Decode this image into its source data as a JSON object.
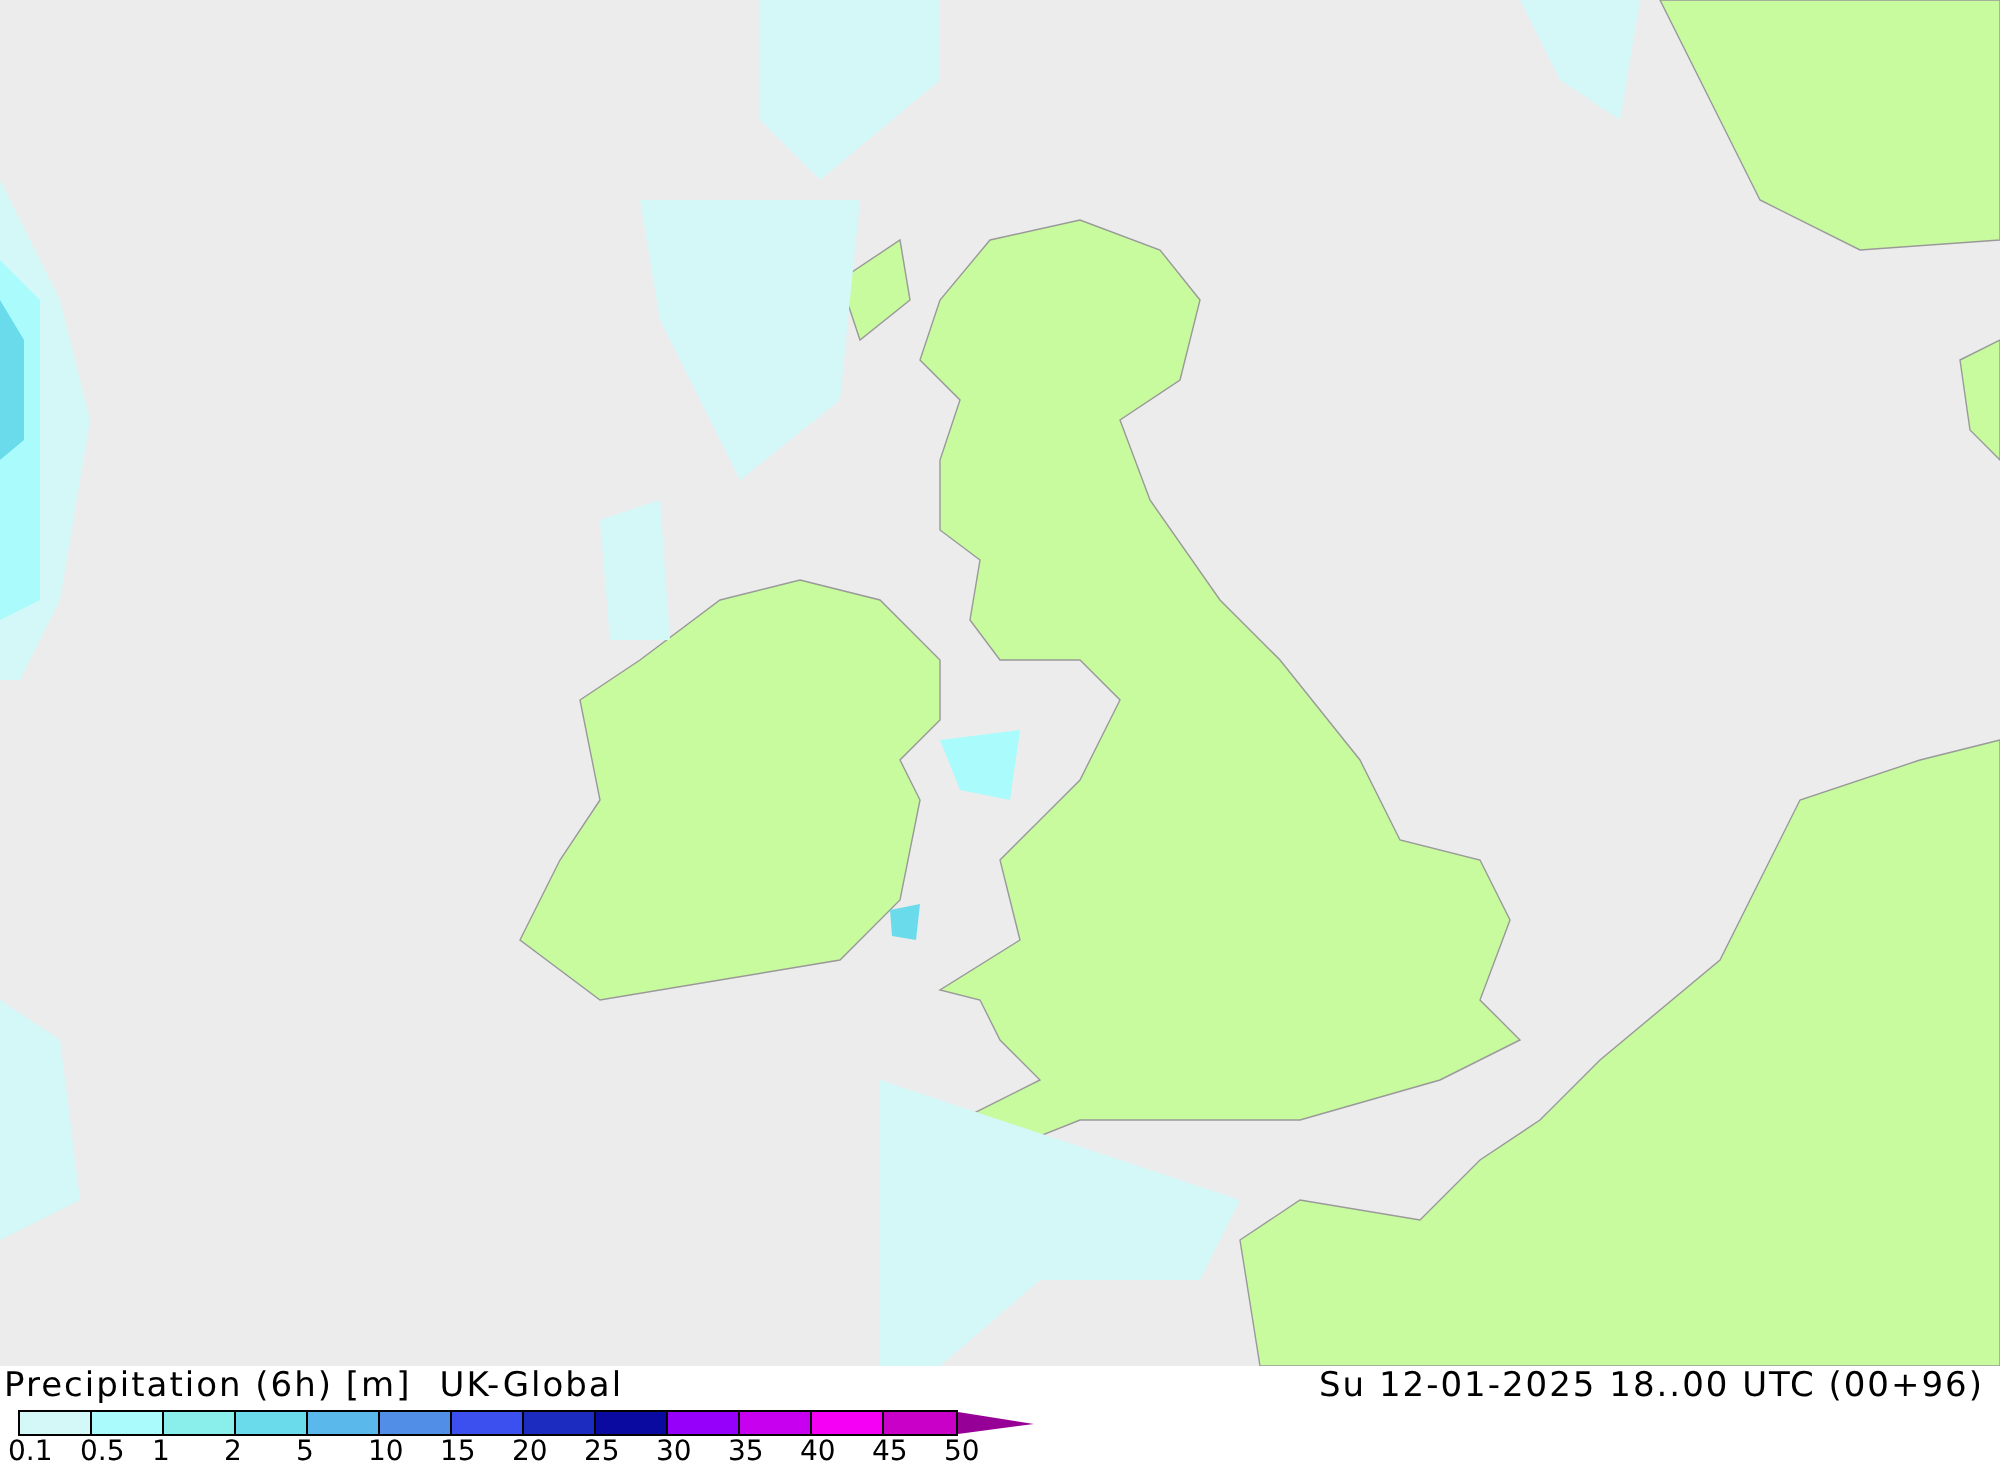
{
  "map": {
    "title": "Precipitation (6h) [m]",
    "model": "UK-Global",
    "valid_time": "Su 12-01-2025 18..00 UTC (00+96)"
  },
  "legend": {
    "swatches": [
      {
        "color": "#d4f7f7"
      },
      {
        "color": "#aafcfc"
      },
      {
        "color": "#8aeeea"
      },
      {
        "color": "#6adbeb"
      },
      {
        "color": "#5ab8ea"
      },
      {
        "color": "#508ee8"
      },
      {
        "color": "#3c50f0"
      },
      {
        "color": "#1c2cc0"
      },
      {
        "color": "#0a0aa0"
      },
      {
        "color": "#9600fa"
      },
      {
        "color": "#c800f0"
      },
      {
        "color": "#f500f5"
      },
      {
        "color": "#c800c8"
      }
    ],
    "arrow": {
      "color": "#960096"
    },
    "labels": [
      "0.1",
      "0.5",
      "1",
      "2",
      "5",
      "10",
      "15",
      "20",
      "25",
      "30",
      "35",
      "40",
      "45",
      "50"
    ]
  }
}
